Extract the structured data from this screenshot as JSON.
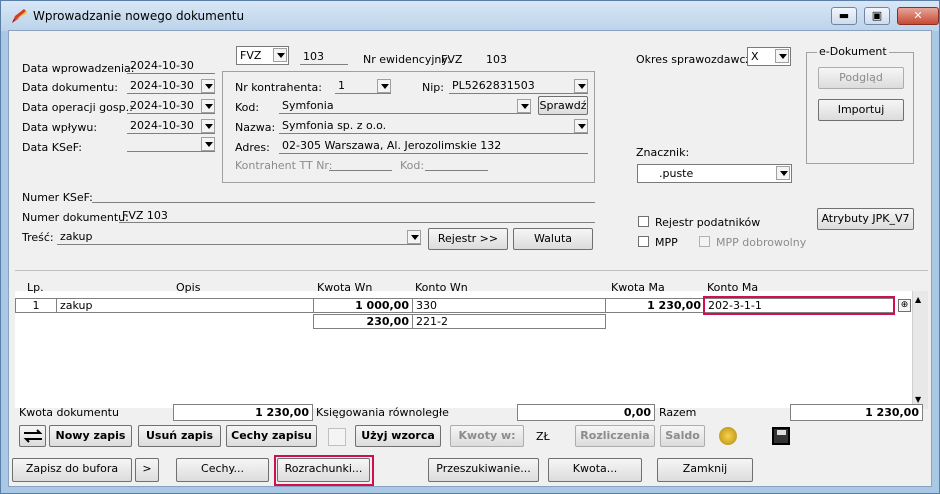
{
  "window": {
    "title": "Wprowadzanie nowego dokumentu",
    "min": "▬",
    "max": "▣",
    "close": "✕"
  },
  "header": {
    "data_wprowadzenia_label": "Data wprowadzenia:",
    "data_wprowadzenia": "2024-10-30",
    "data_dokumentu_label": "Data dokumentu:",
    "data_dokumentu": "2024-10-30",
    "data_operacji_label": "Data operacji gosp.:",
    "data_operacji": "2024-10-30",
    "data_wplywu_label": "Data wpływu:",
    "data_wplywu": "2024-10-30",
    "data_ksef_label": "Data KSeF:",
    "data_ksef": "",
    "doc_type": "FVZ",
    "doc_number": "103",
    "nr_ewidencyjny_label": "Nr ewidencyjny:",
    "nr_ewidencyjny_type": "FVZ",
    "nr_ewidencyjny": "103",
    "okres_label": "Okres sprawozdawczy:",
    "okres": "X"
  },
  "contractor": {
    "nr_label": "Nr kontrahenta:",
    "nr": "1",
    "nip_label": "Nip:",
    "nip": "PL5262831503",
    "kod_label": "Kod:",
    "kod": "Symfonia",
    "sprawdz": "Sprawdź",
    "nazwa_label": "Nazwa:",
    "nazwa": "Symfonia sp. z o.o.",
    "adres_label": "Adres:",
    "adres": "02-305 Warszawa, Al. Jerozolimskie 132",
    "tt_label": "Kontrahent TT Nr:",
    "tt_kod_label": "Kod:"
  },
  "edoc": {
    "legend": "e-Dokument",
    "podglad": "Podgląd",
    "importuj": "Importuj"
  },
  "znacznik": {
    "label": "Znacznik:",
    "value": ".puste"
  },
  "jpk": "Atrybuty JPK_V7",
  "checks": {
    "rejestr": "Rejestr podatników",
    "mpp": "MPP",
    "mpp_dobrowolny": "MPP dobrowolny"
  },
  "numer_ksef_label": "Numer KSeF:",
  "numer_ksef": "",
  "numer_dokumentu_label": "Numer dokumentu:",
  "numer_dokumentu": "FVZ 103",
  "tresc_label": "Treść:",
  "tresc": "zakup",
  "rejestr_btn": "Rejestr >>",
  "waluta_btn": "Waluta",
  "grid": {
    "headers": {
      "lp": "Lp.",
      "opis": "Opis",
      "kwota_wn": "Kwota  Wn",
      "konto_wn": "Konto  Wn",
      "kwota_ma": "Kwota Ma",
      "konto_ma": "Konto Ma"
    },
    "rows": [
      {
        "lp": "1",
        "opis": "zakup",
        "kwota_wn": "1 000,00",
        "konto_wn": "330",
        "kwota_ma": "1 230,00",
        "konto_ma": "202-3-1-1"
      },
      {
        "lp": "",
        "opis": "",
        "kwota_wn": "230,00",
        "konto_wn": "221-2",
        "kwota_ma": "",
        "konto_ma": ""
      }
    ]
  },
  "totals": {
    "kwota_label": "Kwota dokumentu",
    "kwota": "1 230,00",
    "ksieg_label": "Księgowania równoległe",
    "ksieg": "0,00",
    "razem_label": "Razem",
    "razem": "1 230,00"
  },
  "toolbar": {
    "nowy": "Nowy zapis",
    "usun": "Usuń zapis",
    "cechy": "Cechy zapisu",
    "uzyj": "Użyj wzorca",
    "kwoty": "Kwoty w:",
    "waluta": "ZŁ",
    "rozliczenia": "Rozliczenia",
    "saldo": "Saldo"
  },
  "bottom": {
    "zapisz": "Zapisz do bufora",
    "more": ">",
    "cechy": "Cechy...",
    "rozrachunki": "Rozrachunki...",
    "przeszukiwanie": "Przeszukiwanie...",
    "kwota": "Kwota...",
    "zamknij": "Zamknij"
  },
  "colors": {
    "highlight": "#d0104c",
    "titlebar": "#bcd3ea"
  }
}
